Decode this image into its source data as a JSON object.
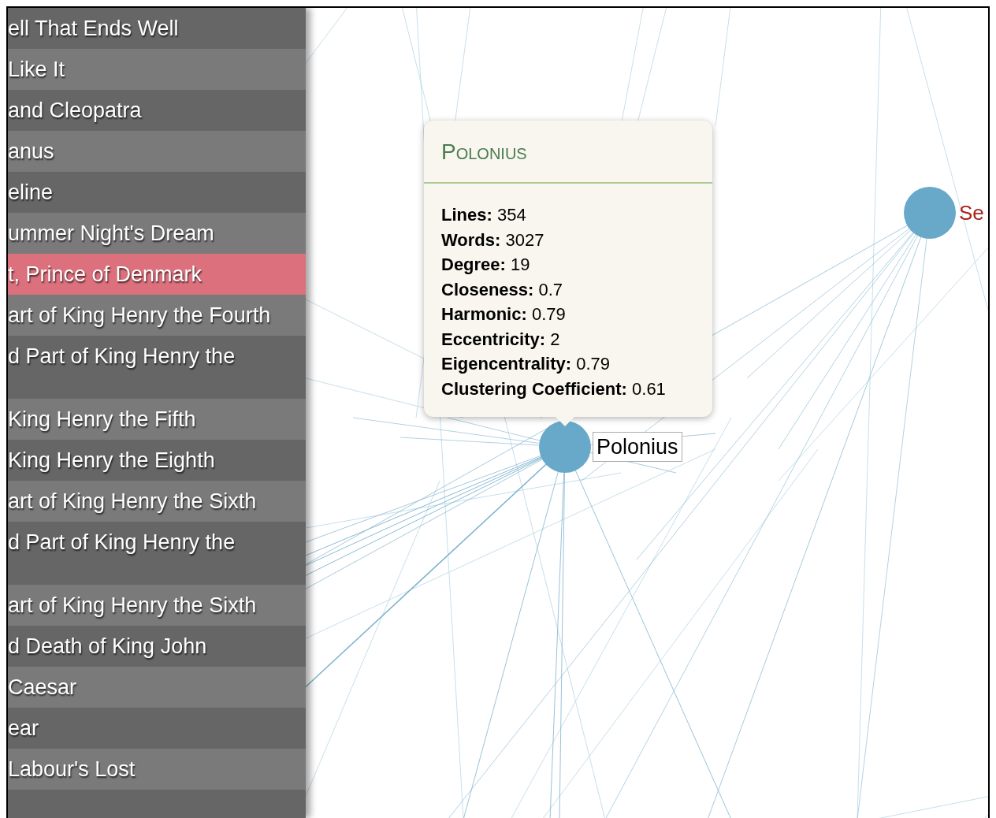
{
  "sidebar": {
    "items": [
      {
        "label": "ell That Ends Well",
        "selected": false,
        "tall": false
      },
      {
        "label": "Like It",
        "selected": false,
        "tall": false
      },
      {
        "label": "and Cleopatra",
        "selected": false,
        "tall": false
      },
      {
        "label": "anus",
        "selected": false,
        "tall": false
      },
      {
        "label": "eline",
        "selected": false,
        "tall": false
      },
      {
        "label": "ummer Night's Dream",
        "selected": false,
        "tall": false
      },
      {
        "label": "t, Prince of Denmark",
        "selected": true,
        "tall": false
      },
      {
        "label": "art of King Henry the Fourth",
        "selected": false,
        "tall": false
      },
      {
        "label": "d Part of King Henry the",
        "selected": false,
        "tall": true
      },
      {
        "label": "King Henry the Fifth",
        "selected": false,
        "tall": false
      },
      {
        "label": "King Henry the Eighth",
        "selected": false,
        "tall": false
      },
      {
        "label": "art of King Henry the Sixth",
        "selected": false,
        "tall": false
      },
      {
        "label": "d Part of King Henry the",
        "selected": false,
        "tall": true
      },
      {
        "label": "art of King Henry the Sixth",
        "selected": false,
        "tall": false
      },
      {
        "label": "d Death of King John",
        "selected": false,
        "tall": false
      },
      {
        "label": "Caesar",
        "selected": false,
        "tall": false
      },
      {
        "label": "ear",
        "selected": false,
        "tall": false
      },
      {
        "label": "Labour's Lost",
        "selected": false,
        "tall": false
      }
    ]
  },
  "tooltip": {
    "title": "Polonius",
    "stats": [
      {
        "label": "Lines:",
        "value": "354"
      },
      {
        "label": "Words:",
        "value": "3027"
      },
      {
        "label": "Degree:",
        "value": "19"
      },
      {
        "label": "Closeness:",
        "value": "0.7"
      },
      {
        "label": "Harmonic:",
        "value": "0.79"
      },
      {
        "label": "Eccentricity:",
        "value": "2"
      },
      {
        "label": "Eigencentrality:",
        "value": "0.79"
      },
      {
        "label": "Clustering Coefficient:",
        "value": "0.61"
      }
    ]
  },
  "nodes": [
    {
      "label": "Polonius",
      "hovered": true
    },
    {
      "label": "Se",
      "hovered": false
    }
  ]
}
